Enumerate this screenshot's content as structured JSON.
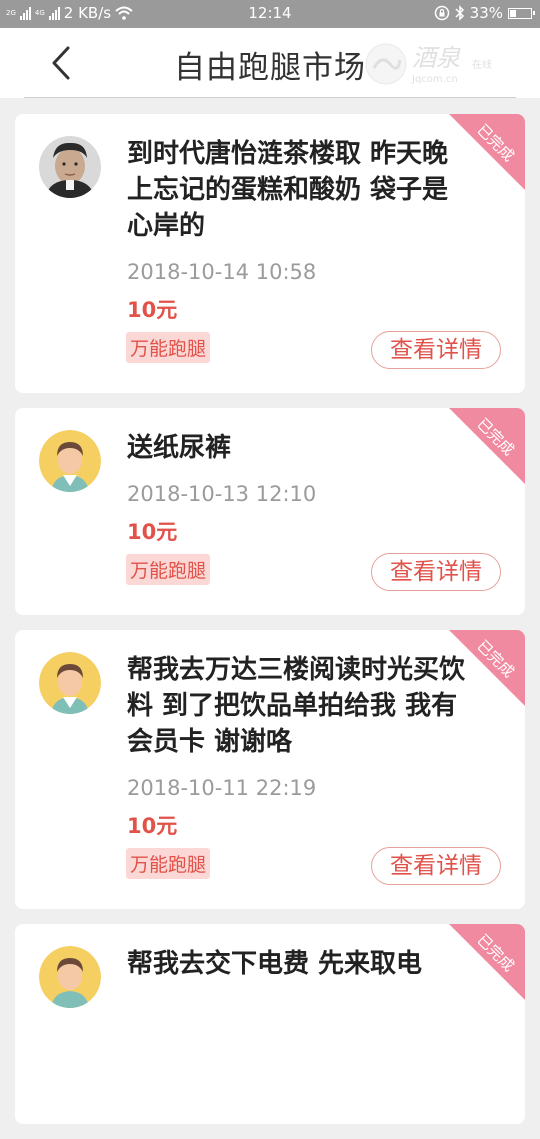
{
  "status_bar": {
    "network": "2G",
    "network2": "4G",
    "speed": "2 KB/s",
    "time": "12:14",
    "battery": "33%",
    "battery_level": 0.33
  },
  "header": {
    "title": "自由跑腿市场",
    "watermark_text": "Jqcom.cn 在线"
  },
  "orders": [
    {
      "title": "到时代唐怡涟茶楼取 昨天晚上忘记的蛋糕和酸奶 袋子是心岸的",
      "time": "2018-10-14 10:58",
      "price": "10元",
      "tag": "万能跑腿",
      "button": "查看详情",
      "status": "已完成",
      "avatar": "photo-avatar-icon"
    },
    {
      "title": "送纸尿裤",
      "time": "2018-10-13 12:10",
      "price": "10元",
      "tag": "万能跑腿",
      "button": "查看详情",
      "status": "已完成",
      "avatar": "default-avatar-icon"
    },
    {
      "title": "帮我去万达三楼阅读时光买饮料 到了把饮品单拍给我 我有会员卡 谢谢咯",
      "time": "2018-10-11 22:19",
      "price": "10元",
      "tag": "万能跑腿",
      "button": "查看详情",
      "status": "已完成",
      "avatar": "default-avatar-icon"
    },
    {
      "title": "帮我去交下电费 先来取电",
      "time": "",
      "price": "",
      "tag": "",
      "button": "",
      "status": "已完成",
      "avatar": "default-avatar-icon"
    }
  ],
  "colors": {
    "accent": "#e0524a",
    "ribbon": "#f08aa0",
    "tag_bg": "#fbd8d5",
    "page_bg": "#efefef",
    "status_bar": "#9a9a9a"
  }
}
